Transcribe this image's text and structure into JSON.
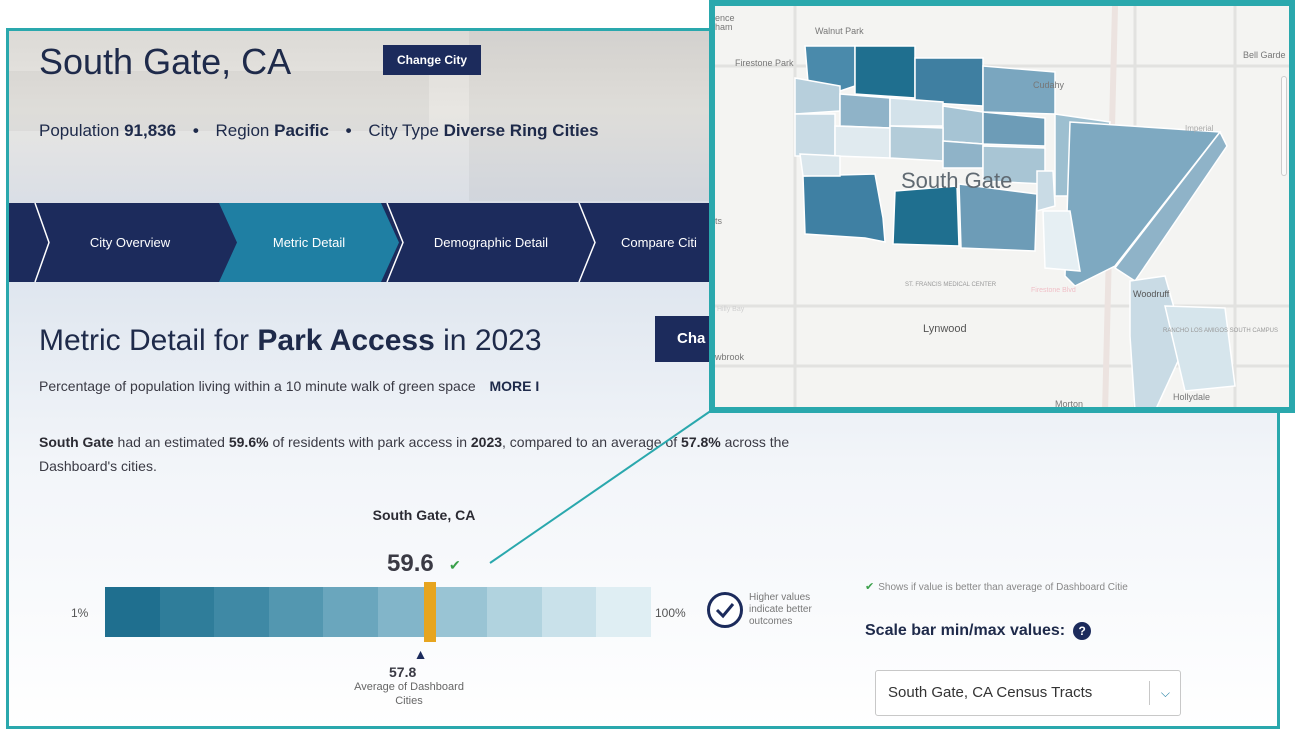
{
  "header": {
    "city_title": "South Gate, CA",
    "change_city_label": "Change City",
    "population_label": "Population",
    "population_value": "91,836",
    "region_label": "Region",
    "region_value": "Pacific",
    "city_type_label": "City Type",
    "city_type_value": "Diverse Ring Cities",
    "separator": "•"
  },
  "nav": {
    "tabs": [
      {
        "label": "City Overview",
        "active": false
      },
      {
        "label": "Metric Detail",
        "active": true
      },
      {
        "label": "Demographic Detail",
        "active": false
      },
      {
        "label": "Compare Citi",
        "active": false
      }
    ]
  },
  "metric": {
    "title_prefix": "Metric Detail for",
    "metric_name": "Park Access",
    "title_in": "in",
    "year": "2023",
    "change_metric_label": "Cha",
    "description": "Percentage of population living within a 10 minute walk of green space",
    "more_link": "MORE I",
    "summary": {
      "city": "South Gate",
      "text1": " had an estimated ",
      "pct": "59.6%",
      "text2": " of residents with park access in ",
      "year": "2023",
      "text3": ", compared to an average of ",
      "avg": "57.8%",
      "text4": " across the Dashboard's cities."
    }
  },
  "scale": {
    "city_name": "South Gate, CA",
    "city_value": "59.6",
    "check_icon": "check-icon",
    "min_label": "1%",
    "max_label": "100%",
    "min": 1,
    "max": 100,
    "city_fraction": 0.596,
    "avg_fraction": 0.578,
    "avg_value": "57.8",
    "avg_label": "Average of Dashboard Cities",
    "segment_colors": [
      "#1f6f8f",
      "#2f7d9a",
      "#3f89a5",
      "#5397b0",
      "#6aa6bd",
      "#82b5c9",
      "#99c4d4",
      "#b1d3df",
      "#c9e1ea",
      "#dfeef3"
    ],
    "marker_color": "#e7a51f",
    "higher_note": "Higher values indicate better outcomes",
    "legend_text": "Shows if value is better than average of Dashboard Citie",
    "minmax_label": "Scale bar min/max values:",
    "help_icon": "?",
    "tract_option": "South Gate, CA Census Tracts"
  },
  "map": {
    "city_label": "South Gate",
    "labels": {
      "walnut_park": "Walnut Park",
      "firestone_park": "Firestone Park",
      "bell_gardens": "Bell Garde",
      "cudahy": "Cudahy",
      "lynwood": "Lynwood",
      "st_francis": "ST. FRANCIS MEDICAL CENTER",
      "firestone_blvd": "Firestone Blvd",
      "willowbrook_frag": "wbrook",
      "ts_frag": "ts",
      "ence_frag": "ence ham",
      "hilly_frag": "Hilly Bay",
      "rancho_los_amigos": "RANCHO LOS AMIGOS SOUTH CAMPUS",
      "hollydale": "Hollydale",
      "morton": "Morton",
      "woodruff": "Woodruff",
      "imperial_frag": "Imperial"
    }
  },
  "colors": {
    "accent": "#2aa8ad",
    "navy": "#1c2b5c",
    "nav_active": "#1f7fa3",
    "check_green": "#3aa04a"
  }
}
